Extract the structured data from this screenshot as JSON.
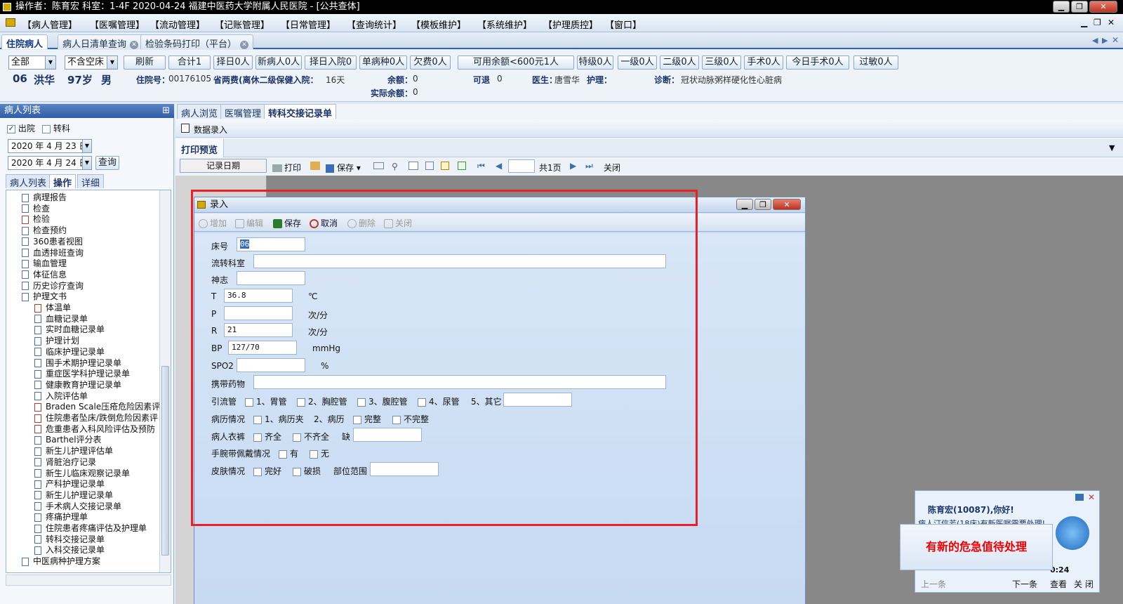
{
  "titlebar": {
    "text": "操作者：陈育宏  科室：1-4F  2020-04-24  福建中医药大学附属人民医院 - [公共查体]",
    "min": "▁",
    "max": "❐",
    "close": "✕"
  },
  "menu": [
    "【病人管理】",
    "【医嘱管理】",
    "【流动管理】",
    "【记账管理】",
    "【日常管理】",
    "【查询统计】",
    "【模板维护】",
    "【系统维护】",
    "【护理质控】",
    "【窗口】"
  ],
  "doc_tabs": [
    "住院病人",
    "病人日清单查询",
    "检验条码打印（平台）"
  ],
  "filter": {
    "ward": "全部",
    "bed": "不含空床",
    "buttons": [
      "刷新",
      "合计1",
      "择日0人",
      "新病人0人",
      "择日入院0人",
      "单病种0人",
      "欠费0人"
    ],
    "balance": "可用余额<600元1人",
    "buttons2": [
      "特级0人",
      "一级0人",
      "二级0人",
      "三级0人",
      "手术0人",
      "今日手术0人",
      "过敏0人"
    ]
  },
  "patient": {
    "bed": "06",
    "name": "洪华",
    "age": "97岁",
    "sex": "男",
    "admno_label": "住院号：",
    "admno": "00176105",
    "insurance": "省两费(离休二级保健入院：",
    "days": "16天",
    "balance_label": "余额：",
    "balance": "0",
    "actual_label": "实际余额：",
    "actual": "0",
    "refund_label": "可退",
    "refund": "0",
    "doctor_label": "医生：",
    "doctor": "唐雪华",
    "nurse_label": "护理：",
    "diag_label": "诊断：",
    "diag": "冠状动脉粥样硬化性心脏病"
  },
  "left": {
    "title": "病人列表",
    "pin": "⊞",
    "chk_out": "出院",
    "chk_transfer": "转科",
    "date1": "2020 年 4 月 23 日",
    "date2": "2020 年 4 月 24 日",
    "query": "查询",
    "tabs": [
      "病人列表",
      "操作",
      "详细"
    ],
    "tree": [
      "病理报告",
      "检查",
      "检验",
      "检查预约",
      "360患者视图",
      "血透排班查询",
      "输血管理",
      "体征信息",
      "历史诊疗查询",
      "护理文书",
      "体温单",
      "血糖记录单",
      "实时血糖记录单",
      "护理计划",
      "临床护理记录单",
      "围手术期护理记录单",
      "重症医学科护理记录单",
      "健康教育护理记录单",
      "入院评估单",
      "Braden Scale压疮危险因素评",
      "住院患者坠床/跌倒危险因素评",
      "危重患者入科风险评估及预防",
      "Barthel评分表",
      "新生儿护理评估单",
      "肾脏治疗记录",
      "新生儿临床观察记录单",
      "产科护理记录单",
      "新生儿护理记录单",
      "手术病人交接记录单",
      "疼痛护理单",
      "住院患者疼痛评估及护理单",
      "转科交接记录单",
      "入科交接记录单",
      "中医病种护理方案"
    ]
  },
  "right": {
    "tabs": [
      "病人浏览",
      "医嘱管理",
      "转科交接记录单"
    ],
    "data_entry": "数据录入",
    "print_preview": "打印预览",
    "col_header": "记录日期",
    "print": "打印",
    "save": "保存",
    "total_pages": "共1页",
    "close": "关闭"
  },
  "dialog": {
    "title": "录入",
    "toolbar": [
      "增加",
      "编辑",
      "保存",
      "取消",
      "删除",
      "关闭"
    ],
    "labels": {
      "bed": "床号",
      "dept": "流转科室",
      "mind": "神志",
      "t": "T",
      "p": "P",
      "r": "R",
      "bp": "BP",
      "spo2": "SPO2",
      "drugs": "携带药物",
      "drain": "引流管",
      "history": "病历情况",
      "clothes": "病人衣裤",
      "band": "手腕带佩戴情况",
      "skin": "皮肤情况"
    },
    "values": {
      "bed": "06",
      "t": "36.8",
      "r": "21",
      "bp": "127/70"
    },
    "units": {
      "t": "℃",
      "p": "次/分",
      "r": "次/分",
      "bp": "mmHg",
      "spo2": "%"
    },
    "drain_opts": [
      "1、胃管",
      "2、胸腔管",
      "3、腹腔管",
      "4、尿管"
    ],
    "drain_other": "5、其它",
    "history_opts": [
      "1、病历夹",
      "2、病历"
    ],
    "complete": "完整",
    "incomplete": "不完整",
    "clothes_opts": [
      "齐全",
      "不齐全"
    ],
    "missing": "缺",
    "band_opts": [
      "有",
      "无"
    ],
    "skin_opts": [
      "完好",
      "破损"
    ],
    "skin_area": "部位范围"
  },
  "notify": {
    "greet": "陈育宏(10087),你好!",
    "msg": "病人汀信芳(18床)有新医嘱需要处理!",
    "alert": "有新的危急值待处理",
    "prev": "上一条",
    "next": "下一条",
    "view": "查看",
    "close": "关 闭",
    "time": "0:24"
  }
}
